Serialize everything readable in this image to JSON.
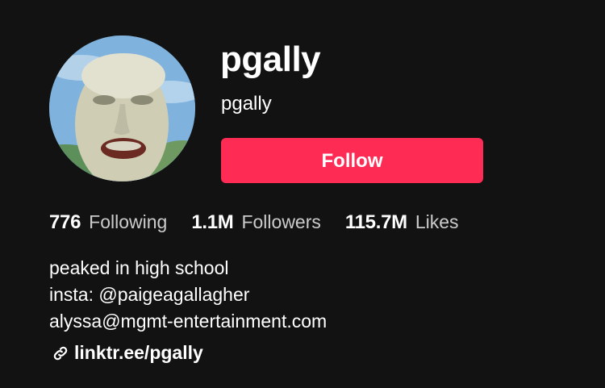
{
  "profile": {
    "username": "pgally",
    "nickname": "pgally",
    "follow_label": "Follow",
    "avatar_icon": "avatar-image"
  },
  "stats": [
    {
      "value": "776",
      "label": "Following"
    },
    {
      "value": "1.1M",
      "label": "Followers"
    },
    {
      "value": "115.7M",
      "label": "Likes"
    }
  ],
  "bio": {
    "lines": [
      "peaked in high school",
      "insta: @paigeagallagher",
      "alyssa@mgmt-entertainment.com"
    ]
  },
  "link": {
    "icon": "link-icon",
    "text": "linktr.ee/pgally"
  },
  "colors": {
    "background": "#121212",
    "follow_button": "#fe2c55",
    "text": "#ffffff"
  }
}
